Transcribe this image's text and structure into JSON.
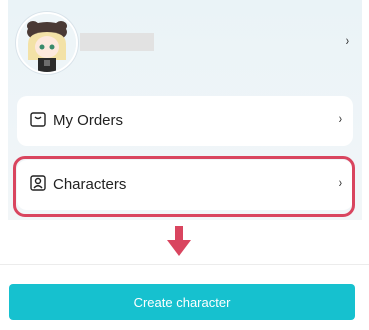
{
  "profile": {
    "chevron": "›",
    "avatar_icon": "anime-character-avatar-icon"
  },
  "menu": {
    "items": [
      {
        "label": "My Orders",
        "icon": "shopping-bag-icon",
        "chevron": "›"
      },
      {
        "label": "Characters",
        "icon": "person-card-icon",
        "chevron": "›"
      }
    ]
  },
  "annotation": {
    "arrow_color": "#d9455f",
    "highlight_color": "#d9455f"
  },
  "cta": {
    "label": "Create character",
    "color": "#16c1cf"
  }
}
